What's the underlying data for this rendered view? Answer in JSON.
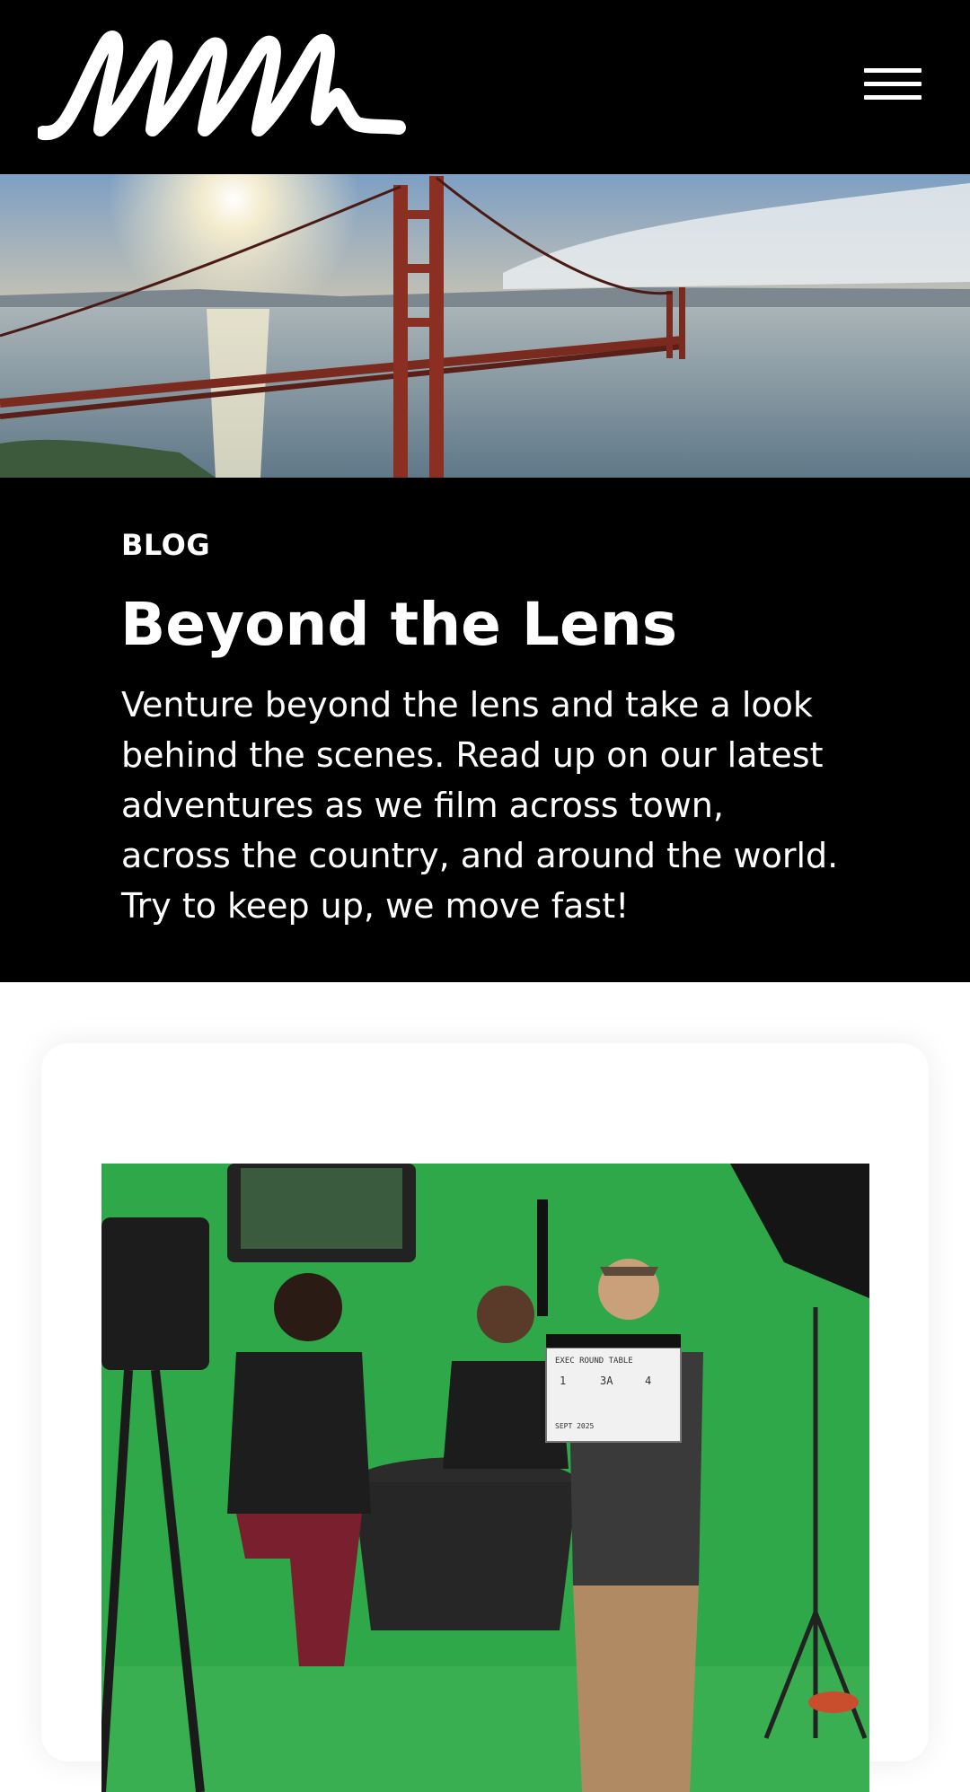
{
  "header": {
    "logo_icon": "mmm-script-logo-icon",
    "menu_icon": "hamburger-menu-icon"
  },
  "hero": {
    "image": "golden-gate-bridge-sunset-photo"
  },
  "intro": {
    "eyebrow": "BLOG",
    "title": "Beyond the Lens",
    "description": "Venture beyond the lens and take a look behind the scenes. Read up on our latest adventures as we film across town, across the country, and around the world. Try to keep up, we move fast!"
  },
  "post": {
    "image": "green-screen-film-set-photo",
    "clapper_board": {
      "prod": "EXEC ROUND TABLE",
      "roll": "1",
      "scene": "3A",
      "take": "4",
      "date": "SEPT 2025"
    }
  },
  "colors": {
    "header_bg": "#000000",
    "intro_bg": "#000000",
    "text_primary": "#ffffff",
    "page_bg": "#ffffff",
    "green_screen": "#2fa84a"
  }
}
